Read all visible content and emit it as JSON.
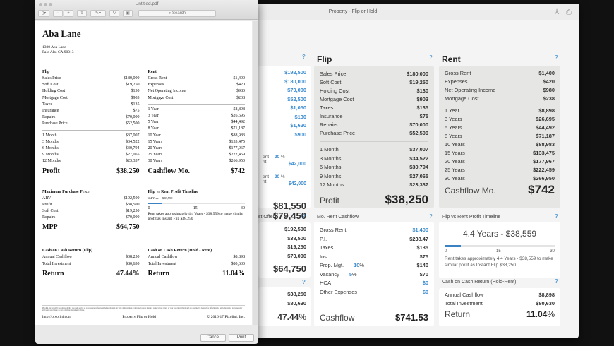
{
  "app": {
    "title": "Property - Flip or Hold",
    "help": "?",
    "left_col": {
      "values": [
        "$192,500",
        "$180,000",
        "$70,000",
        "$52,500",
        "$1,050",
        "$130",
        "$1,620",
        "$900"
      ],
      "down1_label": "ent",
      "down1_sub": "nt",
      "down1_pct": "20",
      "down1_value": "$42,000",
      "down2_label": "ent",
      "down2_sub": "nt",
      "down2_pct": "20",
      "down2_value": "$42,000",
      "pct_sign": "%",
      "total1": "$81,550",
      "total2": "$79,450",
      "mpp_header": "st Offer)",
      "mpp_values": [
        "$192,500",
        "$38,500",
        "$19,250",
        "$70,000"
      ],
      "mpp_total": "$64,750",
      "coc_values": [
        "$38,250",
        "$80,630"
      ],
      "coc_return": "47.44",
      "coc_pct": "%"
    },
    "flip": {
      "title": "Flip",
      "items": [
        [
          "Sales Price",
          "$180,000"
        ],
        [
          "Soft Cost",
          "$19,250"
        ],
        [
          "Holding Cost",
          "$130"
        ],
        [
          "Mortgage Cost",
          "$903"
        ],
        [
          "Taxes",
          "$135"
        ],
        [
          "Insurance",
          "$75"
        ],
        [
          "Repairs",
          "$70,000"
        ],
        [
          "Purchase Price",
          "$52,500"
        ]
      ],
      "months": [
        [
          "1 Month",
          "$37,007"
        ],
        [
          "3 Months",
          "$34,522"
        ],
        [
          "6 Months",
          "$30,794"
        ],
        [
          "9 Months",
          "$27,065"
        ],
        [
          "12 Months",
          "$23,337"
        ]
      ],
      "profit_label": "Profit",
      "profit": "$38,250"
    },
    "rent": {
      "title": "Rent",
      "items": [
        [
          "Gross Rent",
          "$1,400"
        ],
        [
          "Expenses",
          "$420"
        ],
        [
          "Net Operating Income",
          "$980"
        ],
        [
          "Mortgage Cost",
          "$238"
        ]
      ],
      "years": [
        [
          "1 Year",
          "$8,898"
        ],
        [
          "3 Years",
          "$26,695"
        ],
        [
          "5 Years",
          "$44,492"
        ],
        [
          "8 Years",
          "$71,187"
        ],
        [
          "10 Years",
          "$88,983"
        ],
        [
          "15 Years",
          "$133,475"
        ],
        [
          "20 Years",
          "$177,967"
        ],
        [
          "25 Years",
          "$222,459"
        ],
        [
          "30 Years",
          "$266,950"
        ]
      ],
      "cashflow_label": "Cashflow Mo.",
      "cashflow": "$742"
    },
    "mo_rent": {
      "title": "Mo. Rent Cashflow",
      "items": [
        [
          "Gross Rent",
          "",
          "$1,400"
        ],
        [
          "P.I.",
          "",
          "$238.47"
        ],
        [
          "Taxes",
          "",
          "$135"
        ],
        [
          "Ins.",
          "",
          "$75"
        ],
        [
          "Prop. Mgt.",
          "10",
          "$140"
        ],
        [
          "Vacancy",
          "5",
          "$70"
        ],
        [
          "HOA",
          "",
          "$0"
        ],
        [
          "Other Expenses",
          "",
          "$0"
        ]
      ],
      "pct_sign": "%",
      "cashflow_label": "Cashflow",
      "cashflow": "$741.53"
    },
    "timeline": {
      "title": "Flip vs Rent Profit Timeline",
      "headline": "4.4 Years - $38,559",
      "progress_years": 4.4,
      "max_years": 30,
      "ticks": [
        "0",
        "15",
        "30"
      ],
      "note": "Rent takes approximately 4.4 Years - $38,559 to make similar profit as Instant Flip $38,250"
    },
    "coc_rent": {
      "title": "Cash on Cash Return (Hold-Rent)",
      "items": [
        [
          "Annual Cashflow",
          "$8,898"
        ],
        [
          "Total Investment",
          "$80,630"
        ]
      ],
      "return_label": "Return",
      "return": "11.04",
      "pct": "%"
    }
  },
  "pdf": {
    "title": "Untitled.pdf",
    "search_placeholder": "Search",
    "page": {
      "heading": "Aba Lane",
      "addr1": "1300 Aba Lane",
      "addr2": "Palo Alto CA 90013",
      "flip_h": "Flip",
      "flip": [
        [
          "Sales Price",
          "$180,000"
        ],
        [
          "Soft Cost",
          "$19,250"
        ],
        [
          "Holding Cost",
          "$130"
        ],
        [
          "Mortgage Cost",
          "$903"
        ],
        [
          "Taxes",
          "$135"
        ],
        [
          "Insurance",
          "$75"
        ],
        [
          "Repairs",
          "$70,000"
        ],
        [
          "Purchase Price",
          "$52,500"
        ]
      ],
      "flip_months": [
        [
          "1 Month",
          "$37,007"
        ],
        [
          "3 Months",
          "$34,522"
        ],
        [
          "6 Months",
          "$30,794"
        ],
        [
          "9 Months",
          "$27,065"
        ],
        [
          "12 Months",
          "$23,337"
        ]
      ],
      "profit_label": "Profit",
      "profit": "$38,250",
      "rent_h": "Rent",
      "rent": [
        [
          "Gross Rent",
          "$1,400"
        ],
        [
          "Expenses",
          "$420"
        ],
        [
          "Net Operating Income",
          "$980"
        ],
        [
          "Mortgage Cost",
          "$238"
        ]
      ],
      "rent_years": [
        [
          "1 Year",
          "$8,898"
        ],
        [
          "3 Year",
          "$26,695"
        ],
        [
          "5 Year",
          "$44,492"
        ],
        [
          "8 Year",
          "$71,187"
        ],
        [
          "10 Year",
          "$88,983"
        ],
        [
          "15 Years",
          "$133,475"
        ],
        [
          "20 Years",
          "$177,967"
        ],
        [
          "25 Years",
          "$222,459"
        ],
        [
          "30 Years",
          "$266,950"
        ]
      ],
      "cashflow_label": "Cashflow Mo.",
      "cashflow": "$742",
      "mpp_h": "Maximum Purchase Price",
      "mpp": [
        [
          "ARV",
          "$192,500"
        ],
        [
          "Profit",
          "$38,500"
        ],
        [
          "Soft Cost",
          "$19,250"
        ],
        [
          "Repairs",
          "$70,000"
        ]
      ],
      "mpp_label": "MPP",
      "mpp_total": "$64,750",
      "tl_h": "Flip vs Rent Profit Timeline",
      "tl_small": "4.4 Years - $38,559",
      "tl_ticks": [
        "0",
        "15",
        "30"
      ],
      "tl_note": "Rent takes approximately 4.4 Years - $38,559 to make similar profit as Instant Flip $38,250",
      "cocf_h": "Cash on Cash Return (Flip)",
      "cocf": [
        [
          "Annual Cashflow",
          "$38,250"
        ],
        [
          "Total Investment",
          "$80,630"
        ]
      ],
      "cocf_label": "Return",
      "cocf_ret": "47.44%",
      "cocr_h": "Cash on Cash Return (Hold - Rent)",
      "cocr": [
        [
          "Annual Cashflow",
          "$8,898"
        ],
        [
          "Total Investment",
          "$80,630"
        ]
      ],
      "cocr_label": "Return",
      "cocr_ret": "11.04%",
      "disclaimer": "Pixolini, Inc. strongly recommends that you seek advice of a real estate professional before making any type of investment. Calculated results may not reflect actual return of your own investments and are designed to be used for informational and educational purposes only and when used alone do not constitute investment advice.",
      "footer_url": "http://pixolini.com",
      "footer_app": "Property Flip or Hold",
      "footer_copy": "© 2016-17 Pixolini, Inc."
    },
    "cancel": "Cancel",
    "print": "Print"
  }
}
